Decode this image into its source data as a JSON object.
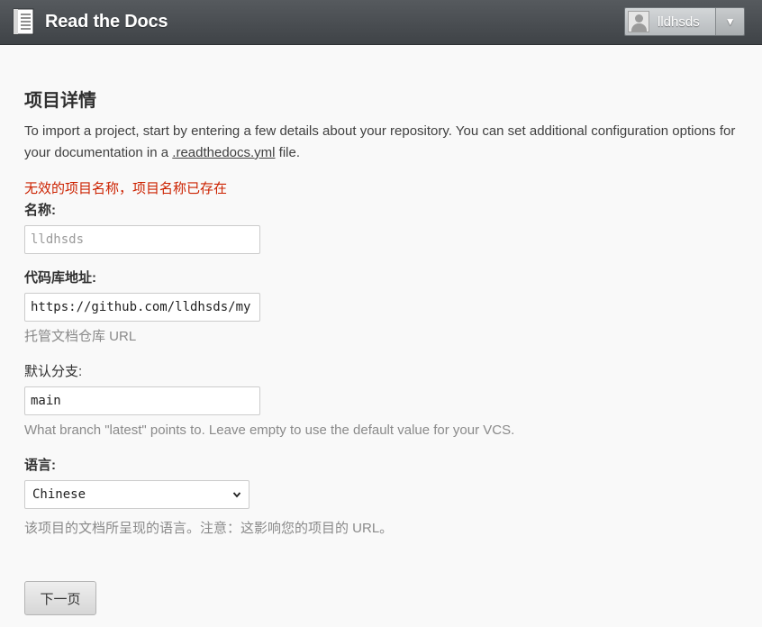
{
  "header": {
    "brand": "Read the Docs",
    "user": {
      "name": "lldhsds",
      "toggle_glyph": "▼"
    }
  },
  "form": {
    "title": "项目详情",
    "intro_before": "To import a project, start by entering a few details about your repository. You can set additional configuration options for your documentation in a ",
    "intro_link": ".readthedocs.yml",
    "intro_after": " file.",
    "error": "无效的项目名称，项目名称已存在",
    "name": {
      "label": "名称:",
      "value": "",
      "placeholder": "lldhsds"
    },
    "repo": {
      "label": "代码库地址:",
      "value": "https://github.com/lldhsds/my",
      "help": "托管文档仓库 URL"
    },
    "branch": {
      "label": "默认分支:",
      "value": "main",
      "help": "What branch \"latest\" points to. Leave empty to use the default value for your VCS."
    },
    "language": {
      "label": "语言:",
      "selected": "Chinese",
      "help": "该项目的文档所呈现的语言。注意：这影响您的项目的 URL。"
    },
    "next_button": "下一页"
  },
  "colors": {
    "header": "#4b4f53",
    "error": "#cc2200",
    "background": "#f9f9f9"
  },
  "icons": {
    "logo": "book-icon",
    "avatar": "avatar-icon",
    "toggle": "caret-down-icon",
    "select": "chevron-down-icon"
  }
}
